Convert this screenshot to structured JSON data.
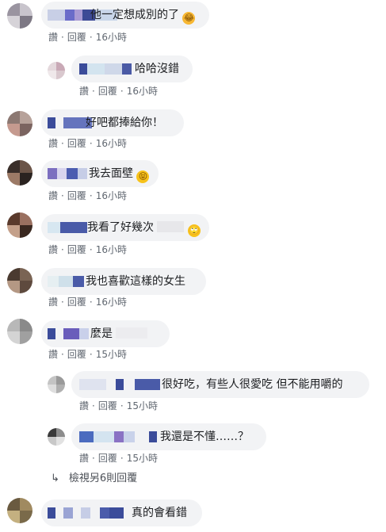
{
  "comments": [
    {
      "text": "他一定想成別的了",
      "emoji": "🤣",
      "actions": {
        "like": "讚",
        "reply": "回覆",
        "time": "16小時"
      }
    },
    {
      "text": "哈哈沒錯",
      "actions": {
        "like": "讚",
        "reply": "回覆",
        "time": "16小時"
      }
    },
    {
      "text": "好吧都捧給你！",
      "actions": {
        "like": "讚",
        "reply": "回覆",
        "time": "16小時"
      }
    },
    {
      "text": "我去面壁",
      "emoji": "😝",
      "actions": {
        "like": "讚",
        "reply": "回覆",
        "time": "16小時"
      }
    },
    {
      "text": "我看了好幾次",
      "emoji": "🙄",
      "actions": {
        "like": "讚",
        "reply": "回覆",
        "time": "16小時"
      }
    },
    {
      "text": "我也喜歡這樣的女生",
      "actions": {
        "like": "讚",
        "reply": "回覆",
        "time": "16小時"
      }
    },
    {
      "text": "麼是",
      "actions": {
        "like": "讚",
        "reply": "回覆",
        "time": "15小時"
      }
    },
    {
      "text": "很好吃，有些人很愛吃 但不能用嚼的",
      "actions": {
        "like": "讚",
        "reply": "回覆",
        "time": "15小時"
      }
    },
    {
      "text": "我還是不懂……？",
      "actions": {
        "like": "讚",
        "reply": "回覆",
        "time": "15小時"
      }
    },
    {
      "text": "真的會看錯"
    }
  ],
  "view_more": {
    "label": "檢視另6則回覆",
    "icon": "reply-arrow-icon"
  },
  "colors": {
    "bubble": "#f2f3f5",
    "name_blue": "#385898",
    "meta": "#606770"
  }
}
